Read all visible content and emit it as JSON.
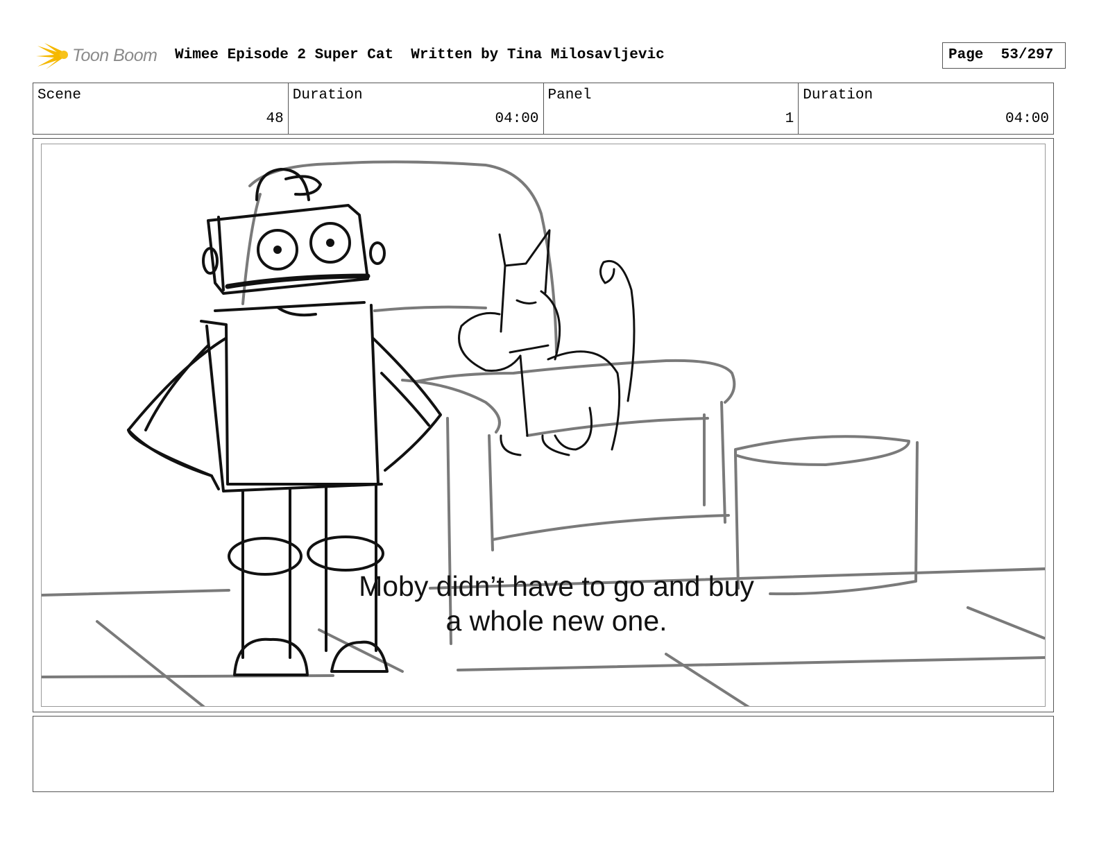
{
  "header": {
    "logo_text": "Toon Boom",
    "title": "Wimee Episode 2 Super Cat  Written by Tina Milosavljevic",
    "page_label": "Page",
    "page_value": "53/297"
  },
  "info": [
    {
      "label": "Scene",
      "value": "48"
    },
    {
      "label": "Duration",
      "value": "04:00"
    },
    {
      "label": "Panel",
      "value": "1"
    },
    {
      "label": "Duration",
      "value": "04:00"
    }
  ],
  "panel": {
    "caption_line1": "Moby didn’t have to go and buy",
    "caption_line2": "a whole new one."
  },
  "notes": {
    "text": ""
  },
  "colors": {
    "logo_accent": "#f5b800",
    "line_dark": "#111111",
    "line_grey": "#7a7a7a",
    "border": "#555555"
  }
}
